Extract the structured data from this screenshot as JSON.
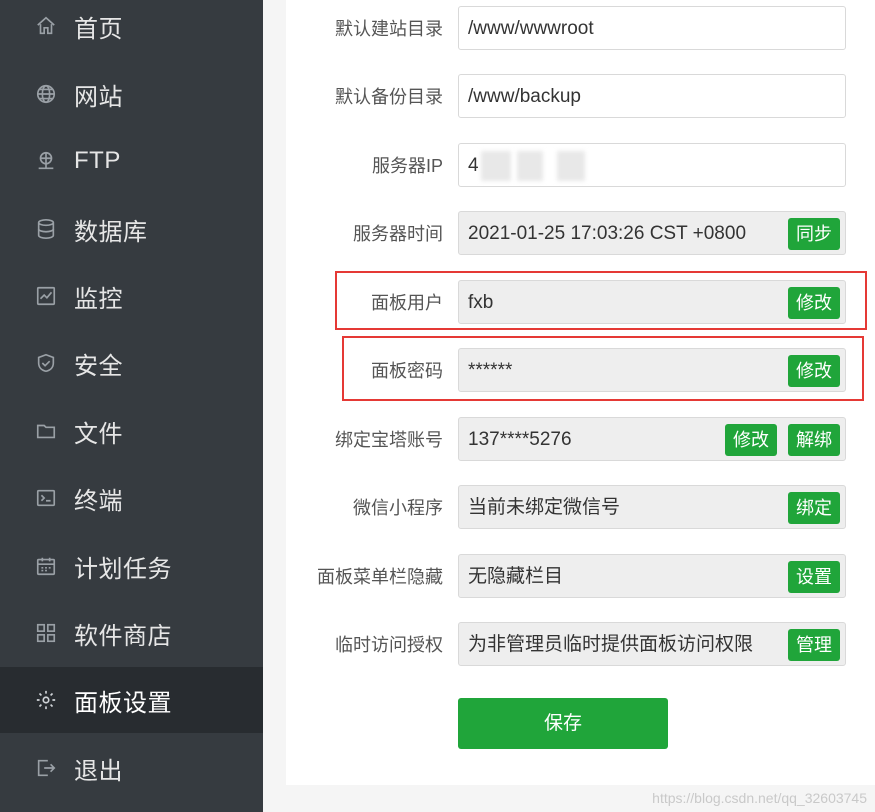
{
  "sidebar": {
    "items": [
      {
        "label": "首页",
        "icon": "home-icon"
      },
      {
        "label": "网站",
        "icon": "globe-icon"
      },
      {
        "label": "FTP",
        "icon": "ftp-icon"
      },
      {
        "label": "数据库",
        "icon": "database-icon"
      },
      {
        "label": "监控",
        "icon": "monitor-icon"
      },
      {
        "label": "安全",
        "icon": "shield-icon"
      },
      {
        "label": "文件",
        "icon": "folder-icon"
      },
      {
        "label": "终端",
        "icon": "terminal-icon"
      },
      {
        "label": "计划任务",
        "icon": "calendar-icon"
      },
      {
        "label": "软件商店",
        "icon": "grid-icon"
      },
      {
        "label": "面板设置",
        "icon": "gear-icon",
        "active": true
      },
      {
        "label": "退出",
        "icon": "logout-icon"
      }
    ]
  },
  "settings": {
    "default_site_dir": {
      "label": "默认建站目录",
      "value": "/www/wwwroot"
    },
    "default_backup_dir": {
      "label": "默认备份目录",
      "value": "/www/backup"
    },
    "server_ip": {
      "label": "服务器IP",
      "value": "4"
    },
    "server_time": {
      "label": "服务器时间",
      "value": "2021-01-25 17:03:26 CST +0800",
      "button": "同步"
    },
    "panel_user": {
      "label": "面板用户",
      "value": "fxb",
      "button": "修改"
    },
    "panel_password": {
      "label": "面板密码",
      "value": "******",
      "button": "修改"
    },
    "bt_account": {
      "label": "绑定宝塔账号",
      "value": "137****5276",
      "button_edit": "修改",
      "button_unbind": "解绑"
    },
    "wechat_miniprogram": {
      "label": "微信小程序",
      "value": "当前未绑定微信号",
      "button": "绑定"
    },
    "menu_hide": {
      "label": "面板菜单栏隐藏",
      "value": "无隐藏栏目",
      "button": "设置"
    },
    "temp_access": {
      "label": "临时访问授权",
      "value": "为非管理员临时提供面板访问权限",
      "button": "管理"
    }
  },
  "save_label": "保存",
  "watermark": "https://blog.csdn.net/qq_32603745",
  "colors": {
    "sidebar_bg": "#363b40",
    "sidebar_active": "#282c30",
    "accent": "#20a53a",
    "highlight": "#e53935"
  }
}
